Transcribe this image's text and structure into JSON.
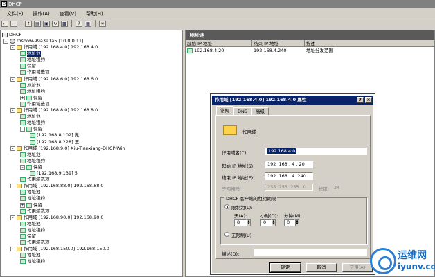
{
  "window": {
    "title": "DHCP"
  },
  "menu": [
    "文件(F)",
    "操作(A)",
    "查看(V)",
    "帮助(H)"
  ],
  "toolbar_icons": [
    "back-icon",
    "forward-icon",
    "up-icon",
    "show-tree-icon",
    "properties-icon",
    "refresh-icon",
    "export-icon",
    "help-icon",
    "view-icon",
    "wand-icon"
  ],
  "tree": {
    "root": "DHCP",
    "server": "roshow-99a391a5 [10.0.0.11]",
    "rows": [
      {
        "text": "作用域 [192.168.4.0] 192.168.4.0",
        "indent": 2,
        "type": "folder",
        "expand": "-"
      },
      {
        "text": "地址池",
        "indent": 3,
        "type": "leaf",
        "selected": true
      },
      {
        "text": "地址租约",
        "indent": 3,
        "type": "leaf"
      },
      {
        "text": "保留",
        "indent": 3,
        "type": "leaf"
      },
      {
        "text": "作用域选项",
        "indent": 3,
        "type": "leaf"
      },
      {
        "text": "作用域 [192.168.6.0] 192.168.6.0",
        "indent": 2,
        "type": "folder",
        "expand": "-"
      },
      {
        "text": "地址池",
        "indent": 3,
        "type": "leaf"
      },
      {
        "text": "地址租约",
        "indent": 3,
        "type": "leaf"
      },
      {
        "text": "保留",
        "indent": 3,
        "type": "leaf",
        "expand": "+"
      },
      {
        "text": "作用域选项",
        "indent": 3,
        "type": "leaf"
      },
      {
        "text": "作用域 [192.168.8.0] 192.168.8.0",
        "indent": 2,
        "type": "folder",
        "expand": "-"
      },
      {
        "text": "地址池",
        "indent": 3,
        "type": "leaf"
      },
      {
        "text": "地址租约",
        "indent": 3,
        "type": "leaf"
      },
      {
        "text": "保留",
        "indent": 3,
        "type": "leaf",
        "expand": "-"
      },
      {
        "text": "[192.168.8.102] 胤",
        "indent": 4,
        "type": "leaf"
      },
      {
        "text": "[192.168.8.228] 王",
        "indent": 4,
        "type": "leaf"
      },
      {
        "text": "作用域 [192.168.9.0] Xiu-Tianxiang-DHCP-Win",
        "indent": 2,
        "type": "folder",
        "expand": "-"
      },
      {
        "text": "地址池",
        "indent": 3,
        "type": "leaf"
      },
      {
        "text": "地址租约",
        "indent": 3,
        "type": "leaf"
      },
      {
        "text": "保留",
        "indent": 3,
        "type": "leaf",
        "expand": "-"
      },
      {
        "text": "[192.168.9.139] 5",
        "indent": 4,
        "type": "leaf"
      },
      {
        "text": "作用域选项",
        "indent": 3,
        "type": "leaf"
      },
      {
        "text": "作用域 [192.168.88.0] 192.168.88.0",
        "indent": 2,
        "type": "folder",
        "expand": "-"
      },
      {
        "text": "地址池",
        "indent": 3,
        "type": "leaf"
      },
      {
        "text": "地址租约",
        "indent": 3,
        "type": "leaf"
      },
      {
        "text": "保留",
        "indent": 3,
        "type": "leaf",
        "expand": "+"
      },
      {
        "text": "作用域选项",
        "indent": 3,
        "type": "leaf"
      },
      {
        "text": "作用域 [192.168.90.0] 192.168.90.0",
        "indent": 2,
        "type": "folder",
        "expand": "-"
      },
      {
        "text": "地址池",
        "indent": 3,
        "type": "leaf"
      },
      {
        "text": "地址租约",
        "indent": 3,
        "type": "leaf"
      },
      {
        "text": "保留",
        "indent": 3,
        "type": "leaf"
      },
      {
        "text": "作用域选项",
        "indent": 3,
        "type": "leaf"
      },
      {
        "text": "作用域 [192.168.150.0] 192.168.150.0",
        "indent": 2,
        "type": "folder",
        "expand": "-"
      },
      {
        "text": "地址池",
        "indent": 3,
        "type": "leaf"
      },
      {
        "text": "地址租约",
        "indent": 3,
        "type": "leaf"
      }
    ]
  },
  "right": {
    "title": "地址池",
    "columns": [
      "起始 IP 地址",
      "结束 IP 地址",
      "描述"
    ],
    "rows": [
      [
        "192.168.4.20",
        "192.168.4.240",
        "地址分发范围"
      ]
    ]
  },
  "dialog": {
    "title": "作用域 [192.168.4.0] 192.168.4.0 属性",
    "tabs": [
      "常规",
      "DNS",
      "高级"
    ],
    "header_label": "作用域",
    "scope_name_label": "作用域名(C):",
    "scope_name_value": "192.168.4.0",
    "start_ip_label": "起始 IP 地址(S):",
    "start_ip_value": "192 .168 . 4 . 20",
    "end_ip_label": "结束 IP 地址(E):",
    "end_ip_value": "192 .168 . 4 .240",
    "mask_label": "子网掩码:",
    "mask_value": "255 .255 .255 . 0",
    "length_label": "长度:",
    "length_value": "24",
    "lease_group": "DHCP 客户端的租约期限",
    "limited_label": "限制为(L):",
    "days_label": "天(A):",
    "days_value": "8",
    "hours_label": "小时(O):",
    "hours_value": "0",
    "minutes_label": "分钟(M):",
    "minutes_value": "0",
    "unlimited_label": "无限制(U)",
    "desc_label": "描述(D):",
    "desc_value": "",
    "ok": "确定",
    "cancel": "取消",
    "apply": "应用(A)"
  },
  "watermark": {
    "line1": "运维网",
    "line2": "iyunv.com"
  }
}
